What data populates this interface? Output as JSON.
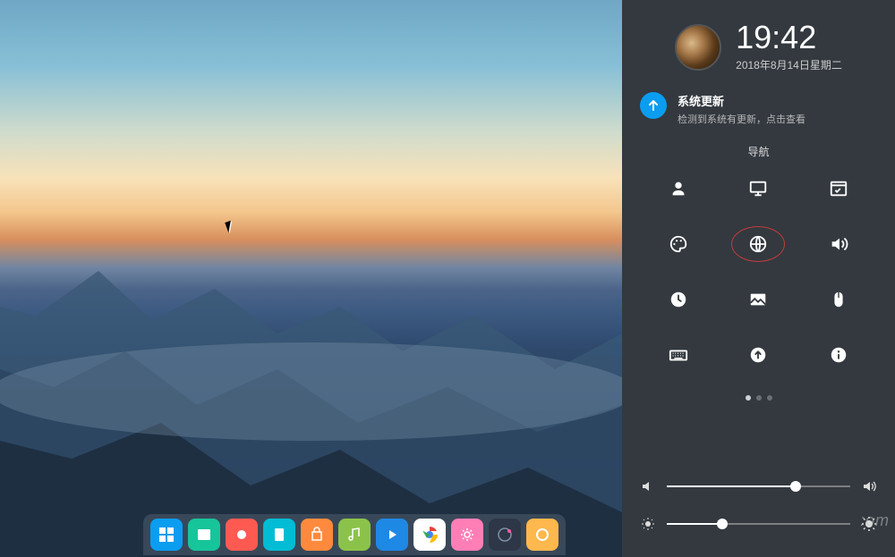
{
  "clock": {
    "time": "19:42",
    "date": "2018年8月14日星期二"
  },
  "notification": {
    "title": "系统更新",
    "description": "检测到系统有更新，点击查看"
  },
  "nav": {
    "title": "导航",
    "items": [
      {
        "name": "account"
      },
      {
        "name": "display"
      },
      {
        "name": "default-apps"
      },
      {
        "name": "personalization"
      },
      {
        "name": "network"
      },
      {
        "name": "sound"
      },
      {
        "name": "time"
      },
      {
        "name": "wallpaper"
      },
      {
        "name": "mouse"
      },
      {
        "name": "keyboard"
      },
      {
        "name": "update"
      },
      {
        "name": "info"
      }
    ],
    "highlighted_index": 4,
    "page_count": 3,
    "active_page": 0
  },
  "sliders": {
    "volume_percent": 70,
    "brightness_percent": 30
  },
  "dock": [
    {
      "name": "launcher",
      "color": "#0b9df0"
    },
    {
      "name": "file-manager",
      "color": "#17c59b"
    },
    {
      "name": "screen-recorder",
      "color": "#ff5a52"
    },
    {
      "name": "reader",
      "color": "#00bcd4"
    },
    {
      "name": "app-store",
      "color": "#ff8a3d"
    },
    {
      "name": "music",
      "color": "#8bc34a"
    },
    {
      "name": "video",
      "color": "#1e88e5"
    },
    {
      "name": "chrome",
      "color": "#ffffff"
    },
    {
      "name": "settings",
      "color": "#ff7eb6"
    },
    {
      "name": "monitor",
      "color": "#2d3748"
    },
    {
      "name": "browser",
      "color": "#ffb84d"
    }
  ],
  "watermark": ":om"
}
